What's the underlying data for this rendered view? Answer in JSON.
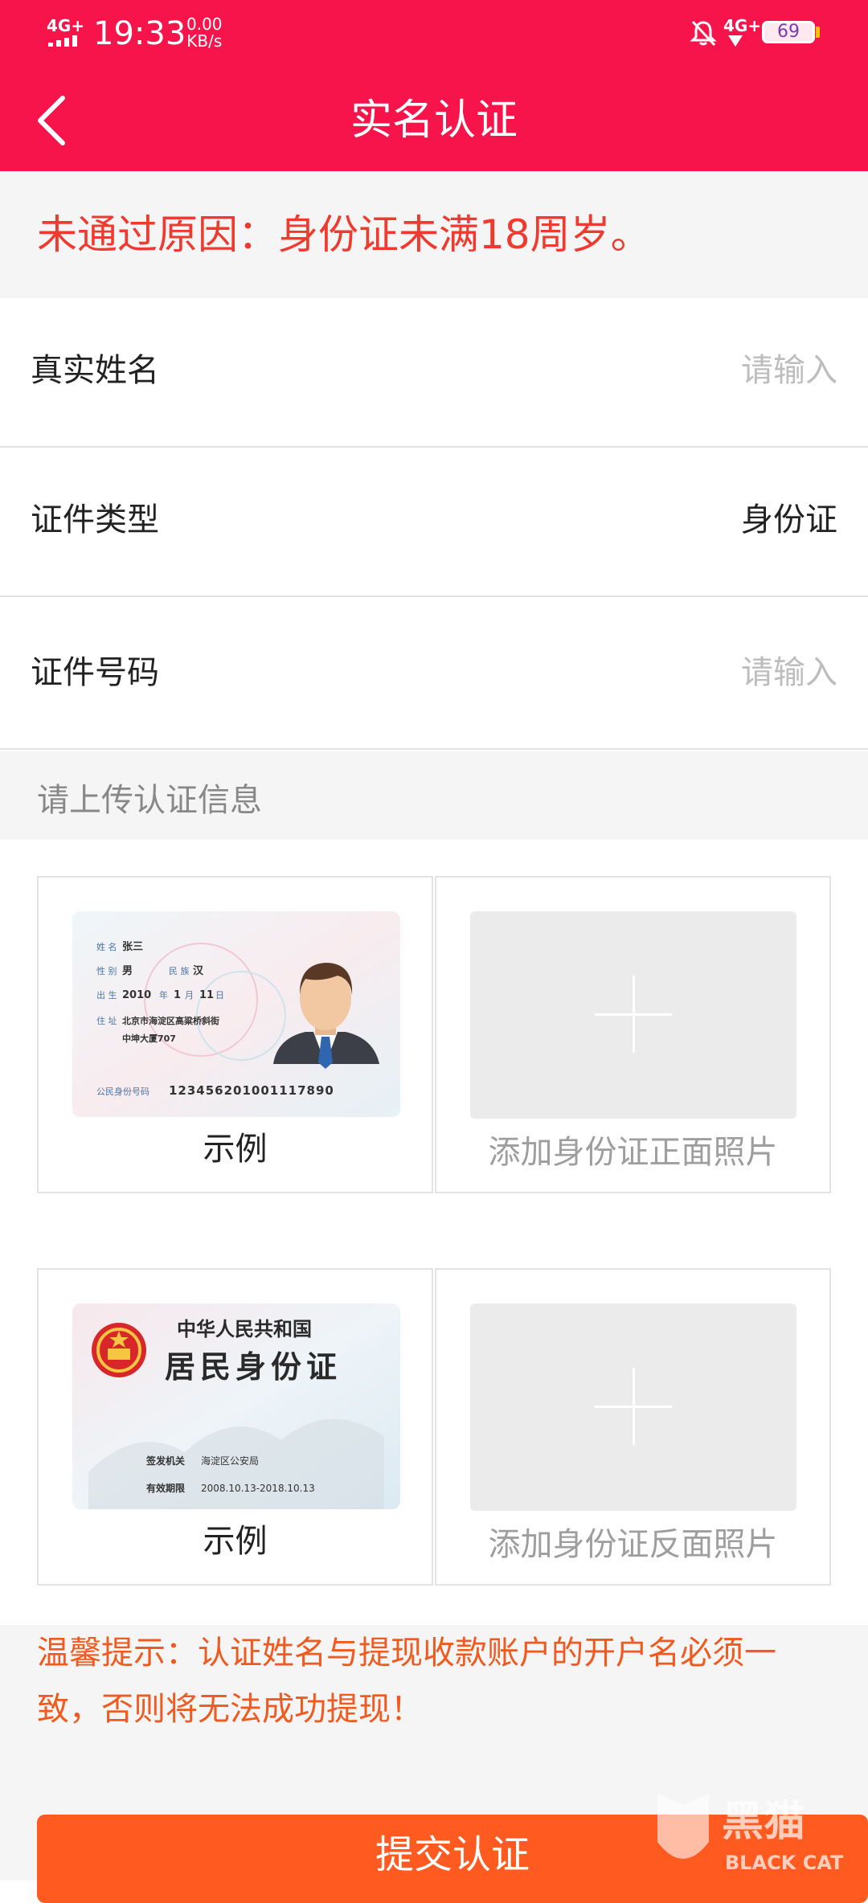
{
  "status_bar": {
    "network_left": "4G+",
    "time": "19:33",
    "speed_value": "0.00",
    "speed_unit": "KB/s",
    "network_right": "4G+",
    "battery": "69"
  },
  "header": {
    "title": "实名认证",
    "back_icon": "chevron-left-icon",
    "background": "#f7144a"
  },
  "notice": {
    "text": "未通过原因：身份证未满18周岁。",
    "color": "#ef3b2f"
  },
  "form": {
    "name": {
      "label": "真实姓名",
      "placeholder": "请输入"
    },
    "id_type": {
      "label": "证件类型",
      "value": "身份证"
    },
    "id_number": {
      "label": "证件号码",
      "placeholder": "请输入"
    }
  },
  "upload_section": {
    "title": "请上传认证信息",
    "front": {
      "sample_caption": "示例",
      "upload_label": "添加身份证正面照片",
      "sample_card": {
        "name_label": "姓 名",
        "name": "张三",
        "gender_label": "性 别",
        "gender": "男",
        "ethnicity_label": "民 族",
        "ethnicity": "汉",
        "birth_label": "出 生",
        "birth_year": "2010",
        "birth_year_unit": "年",
        "birth_month": "1",
        "birth_month_unit": "月",
        "birth_day": "11",
        "birth_day_unit": "日",
        "address_label": "住 址",
        "address_line1": "北京市海淀区高粱桥斜街",
        "address_line2": "中坤大厦707",
        "id_label": "公民身份号码",
        "id_number": "123456201001117890"
      }
    },
    "back": {
      "sample_caption": "示例",
      "upload_label": "添加身份证反面照片",
      "sample_card": {
        "country": "中华人民共和国",
        "card_title": "居民身份证",
        "authority_label": "签发机关",
        "authority": "海淀区公安局",
        "validity_label": "有效期限",
        "validity": "2008.10.13-2018.10.13"
      }
    }
  },
  "tip": {
    "line1": "温馨提示：认证姓名与提现收款账户的开户名必须一",
    "line2": "致，否则将无法成功提现！",
    "color": "#f05a1f"
  },
  "submit": {
    "label": "提交认证",
    "color": "#ff5a1f"
  },
  "watermark": {
    "text_cn": "黑猫",
    "text_en": "BLACK CAT"
  }
}
